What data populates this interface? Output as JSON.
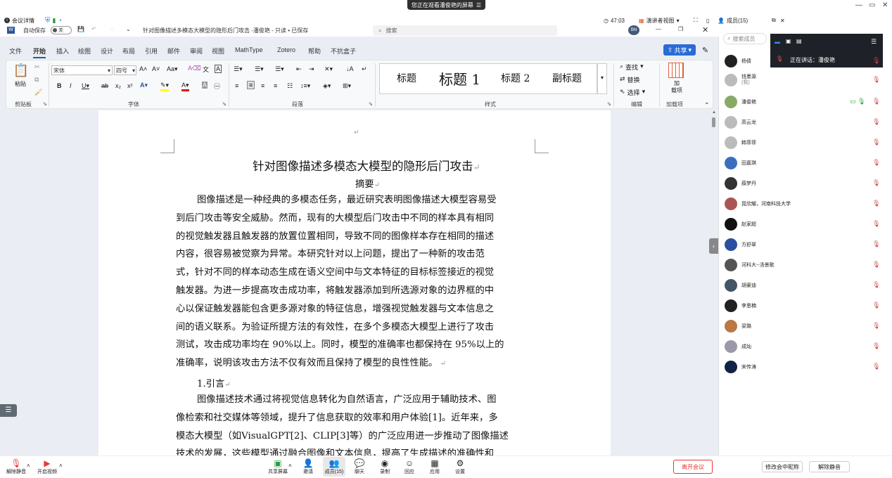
{
  "meeting_top": {
    "details_label": "会议详情",
    "share_banner": "您正在观看潘俊艳的屏幕",
    "timer": "47:03",
    "view_mode": "演讲者视图",
    "members_count": "成员(15)"
  },
  "word": {
    "autosave_label": "自动保存",
    "autosave_state": "关",
    "doc_title": "针对图像描述多模态大模型的隐形后门攻击 -潘俊艳 - 只读 • 已保存",
    "search_placeholder": "搜索",
    "user_badge": "BN",
    "share_button": "共享",
    "tabs": [
      "文件",
      "开始",
      "插入",
      "绘图",
      "设计",
      "布局",
      "引用",
      "邮件",
      "审阅",
      "视图",
      "MathType",
      "Zotero",
      "帮助",
      "不抗盒子"
    ],
    "active_tab": "开始",
    "ribbon": {
      "paste": "粘贴",
      "font_name": "宋体",
      "font_size": "四号",
      "styles": [
        "标题",
        "标题 1",
        "标题 2",
        "副标题"
      ],
      "find": "查找",
      "replace": "替换",
      "select": "选择",
      "addin": "加载项",
      "addin_line1": "加",
      "addin_line2": "载项",
      "groups": [
        "剪贴板",
        "字体",
        "段落",
        "样式",
        "编辑",
        "加载项"
      ]
    }
  },
  "document": {
    "title": "针对图像描述多模态大模型的隐形后门攻击",
    "abstract_heading": "摘要",
    "abstract_lines": [
      "图像描述是一种经典的多模态任务，最近研究表明图像描述大模型容易受",
      "到后门攻击等安全威胁。然而，现有的大模型后门攻击中不同的样本具有相同",
      "的视觉触发器且触发器的放置位置相同，导致不同的图像样本存在相同的描述",
      "内容，很容易被觉察为异常。本研究针对以上问题，提出了一种新的攻击范",
      "式，针对不同的样本动态生成在语义空间中与文本特征的目标标签接近的视觉",
      "触发器。为进一步提高攻击成功率，将触发器添加到所选源对象的边界框的中",
      "心以保证触发器能包含更多源对象的特征信息，增强视觉触发器与文本信息之",
      "间的语义联系。为验证所提方法的有效性，在多个多模态大模型上进行了攻击",
      "测试，攻击成功率均在 90%以上。同时，模型的准确率也都保持在 95%以上的",
      "准确率，说明该攻击方法不仅有效而且保持了模型的良性性能。"
    ],
    "intro_heading": "1.引言",
    "intro_lines": [
      "图像描述技术通过将视觉信息转化为自然语言，广泛应用于辅助技术、图",
      "像检索和社交媒体等领域，提升了信息获取的效率和用户体验[1]。近年来，多",
      "模态大模型（如VisualGPT[2]、CLIP[3]等）的广泛应用进一步推动了图像描述",
      "技术的发展，这些模型通过融合图像和文本信息，提高了生成描述的准确性和"
    ]
  },
  "panel": {
    "search_placeholder": "搜索成员",
    "speaking_label": "正在讲话：潘俊艳",
    "members": [
      {
        "name": "杨倩",
        "color": "#222"
      },
      {
        "name": "钱墨源",
        "sub": "(我)",
        "color": "#bbb"
      },
      {
        "name": "潘俊艳",
        "color": "#8a6"
      },
      {
        "name": "高云龙",
        "color": "#bbb"
      },
      {
        "name": "韩菲菲",
        "color": "#bbb"
      },
      {
        "name": "田嘉琪",
        "color": "#3a6fc0"
      },
      {
        "name": "薛梦丹",
        "color": "#333"
      },
      {
        "name": "晁欣耀，河南科技大学",
        "color": "#a55"
      },
      {
        "name": "赵家超",
        "color": "#111"
      },
      {
        "name": "方舒翠",
        "color": "#2b4fa0"
      },
      {
        "name": "河科大--汤景歌",
        "color": "#555"
      },
      {
        "name": "胡豪迪",
        "color": "#456"
      },
      {
        "name": "李思楠",
        "color": "#222"
      },
      {
        "name": "梁璐",
        "color": "#b74"
      },
      {
        "name": "成灿",
        "color": "#99a"
      },
      {
        "name": "宋传涛",
        "color": "#124"
      }
    ]
  },
  "toolbar": {
    "unmute": "解除静音",
    "video": "开启视频",
    "share": "共享屏幕",
    "invite": "邀请",
    "members": "成员(15)",
    "chat": "聊天",
    "record": "录制",
    "replay": "回应",
    "apps": "应用",
    "settings": "设置",
    "leave": "离开会议",
    "rename": "修改会中昵称",
    "unmute_all": "解除静音"
  }
}
